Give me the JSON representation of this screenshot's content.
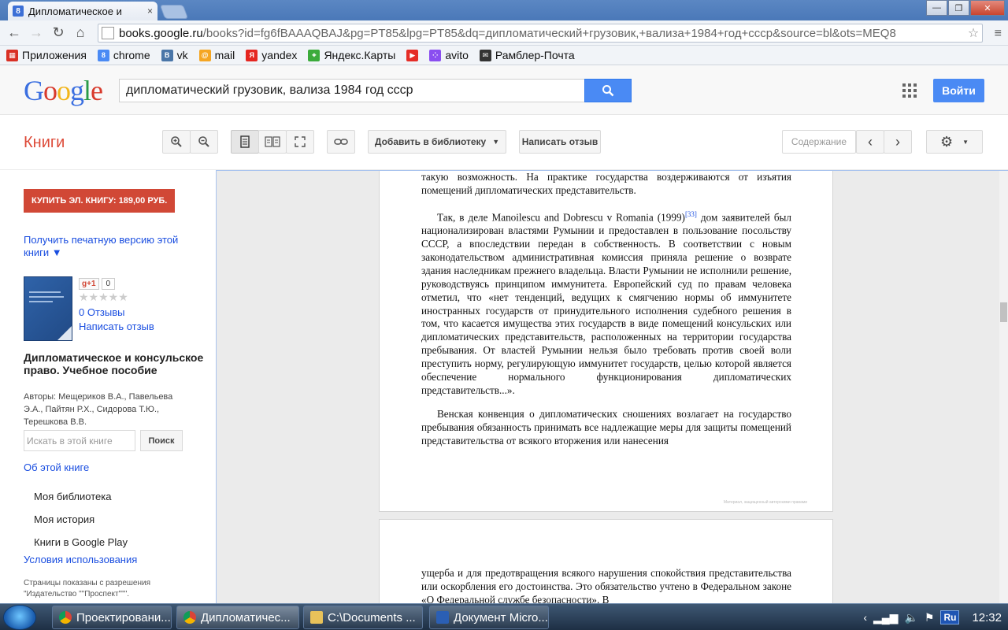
{
  "browser": {
    "tab_title": "Дипломатическое и",
    "tab_close": "×",
    "tab_favicon": "8",
    "url_domain": "books.google.ru",
    "url_path": "/books?id=fg6fBAAAQBAJ&pg=PT85&lpg=PT85&dq=дипломатический+грузовик,+вализа+1984+год+ссср&source=bl&ots=MEQ8",
    "window_buttons": [
      "—",
      "❐",
      "✕"
    ]
  },
  "bookmarks": [
    {
      "label": "Приложения",
      "icon": "apps-icon",
      "color": "#d93025",
      "glyph": "▦"
    },
    {
      "label": "chrome",
      "icon": "google-icon",
      "color": "#4a8af4",
      "glyph": "8"
    },
    {
      "label": "vk",
      "icon": "vk-icon",
      "color": "#4a76a8",
      "glyph": "B"
    },
    {
      "label": "mail",
      "icon": "mail-icon",
      "color": "#f5a623",
      "glyph": "@"
    },
    {
      "label": "yandex",
      "icon": "yandex-icon",
      "color": "#e52620",
      "glyph": "Я"
    },
    {
      "label": "Яндекс.Карты",
      "icon": "maps-icon",
      "color": "#3bab3b",
      "glyph": "⌖"
    },
    {
      "label": "",
      "icon": "youtube-icon",
      "color": "#e52d27",
      "glyph": "▶"
    },
    {
      "label": "avito",
      "icon": "avito-icon",
      "color": "#8a4ef0",
      "glyph": "⁘"
    },
    {
      "label": "Рамблер-Почта",
      "icon": "rambler-icon",
      "color": "#333333",
      "glyph": "✉"
    }
  ],
  "google": {
    "logo": "Google",
    "query": "дипломатический грузовик, вализа 1984 год ссср",
    "signin": "Войти"
  },
  "toolbar": {
    "section": "Книги",
    "add_library": "Добавить в библиотеку",
    "write_review": "Написать отзыв",
    "contents": "Содержание"
  },
  "sidebar": {
    "buy": "КУПИТЬ ЭЛ. КНИГУ: 189,00 РУБ.",
    "print_version": "Получить печатную версию этой книги ▼",
    "gplus": "g+1",
    "gplus_count": "0",
    "stars": "★★★★★",
    "reviews": "0 Отзывы",
    "write_review": "Написать отзыв",
    "book_title": "Дипломатическое и консульское право. Учебное пособие",
    "authors": "Авторы: Мещериков В.А., Павельева Э.А., Пайтян Р.Х., Сидорова Т.Ю., Терешкова В.В.",
    "search_placeholder": "Искать в этой книге",
    "search_button": "Поиск",
    "about": "Об этой книге",
    "my_library": "Моя библиотека",
    "my_history": "Моя история",
    "play_books": "Книги в Google Play",
    "terms": "Условия использования",
    "pages_note": "Страницы показаны с разрешения \"Издательство \"\"Проспект\"\"\"."
  },
  "page": {
    "p0": "такую возможность. На практике государства воздерживаются от изъятия помещений дипломатических представительств.",
    "p1_start": "Так, в деле Manoilescu and Dobrescu v Romania (1999)",
    "p1_fn": "[33]",
    "p1_rest": " дом заявителей был национализирован властями Румынии и предоставлен в пользование посольству СССР, а впоследствии передан в собственность. В соответствии с новым законодательством административная комиссия приняла решение о возврате здания наследникам прежнего владельца. Власти Румынии не исполнили решение, руководствуясь принципом иммунитета. Европейский суд по правам человека отметил, что «нет тенденций, ведущих к смягчению нормы об иммунитете иностранных государств от принудительного исполнения судебного решения в том, что касается имущества этих государств в виде помещений консульских или дипломатических представительств, расположенных на территории государства пребывания. От властей Румынии нельзя было требовать против своей воли преступить норму, регулирующую иммунитет государств, целью которой является обеспечение нормального функционирования дипломатических представительств...».",
    "p2": "Венская конвенция о дипломатических сношениях возлагает на государство пребывания обязанность принимать все надлежащие меры для защиты помещений представительства от всякого вторжения или нанесения",
    "watermark": "Материал, защищенный авторскими правами",
    "p3": "ущерба и для предотвращения всякого нарушения спокойствия представительства или оскорбления его достоинства. Это обязательство учтено в Федеральном законе «О Федеральной службе безопасности». В"
  },
  "taskbar": {
    "tasks": [
      {
        "label": "Проектировани...",
        "icon": "chrome-icon"
      },
      {
        "label": "Дипломатичес...",
        "icon": "chrome-icon"
      },
      {
        "label": "C:\\Documents ...",
        "icon": "folder-icon"
      },
      {
        "label": "Документ Micro...",
        "icon": "word-icon"
      }
    ],
    "lang": "Ru",
    "clock": "12:32"
  }
}
